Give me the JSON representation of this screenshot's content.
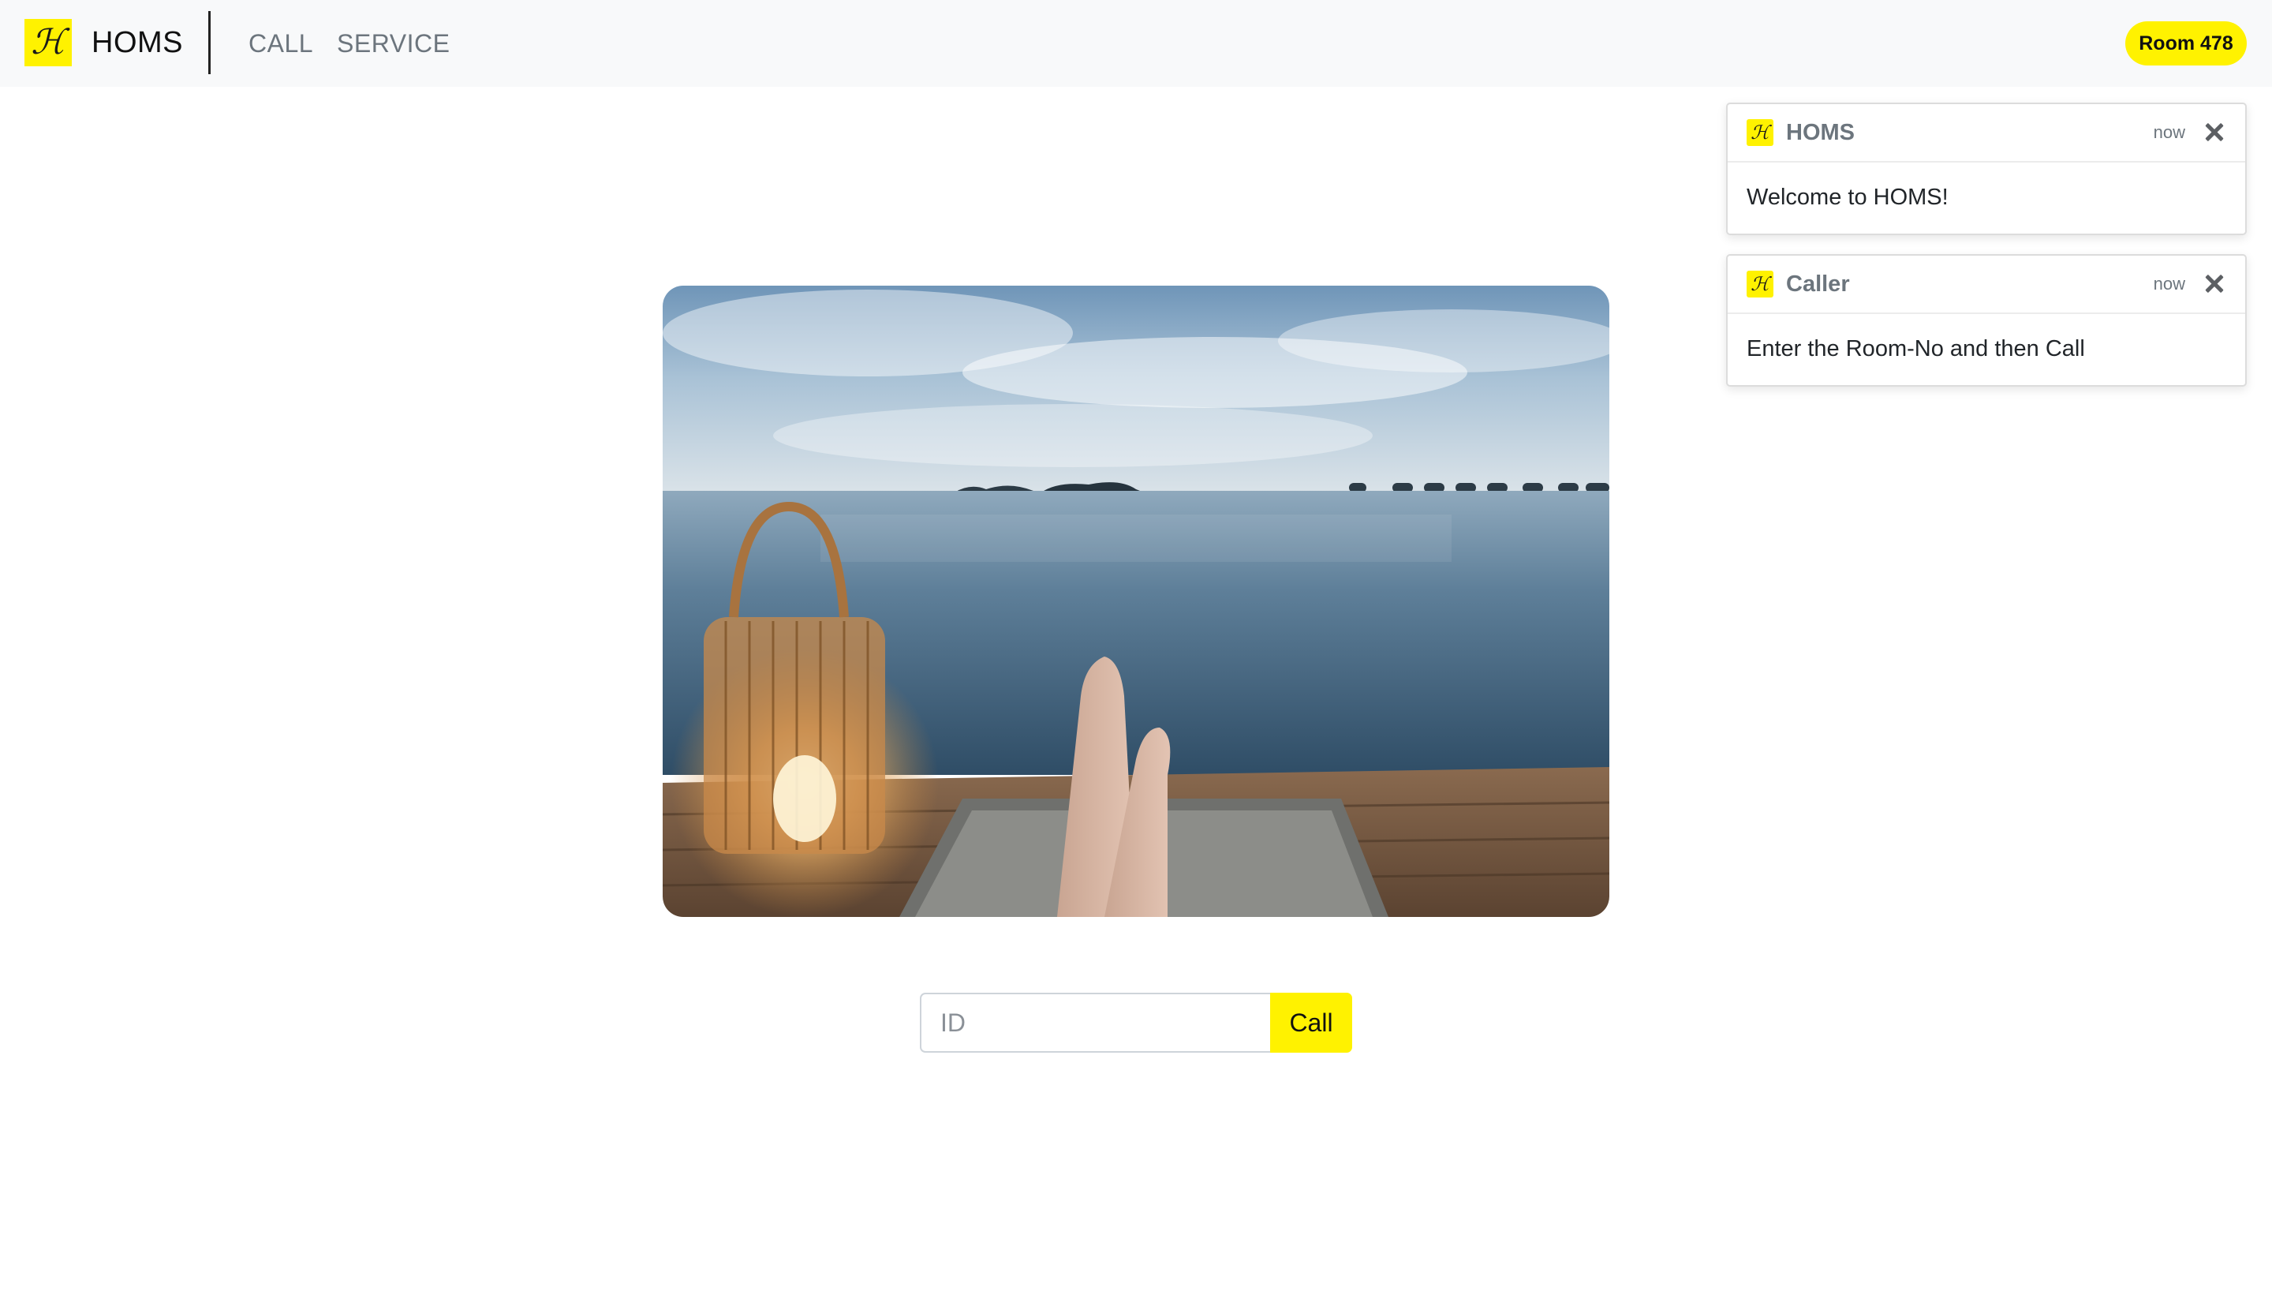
{
  "header": {
    "logo_glyph": "ℋ",
    "brand": "HOMS",
    "nav": [
      {
        "label": "CALL"
      },
      {
        "label": "SERVICE"
      }
    ],
    "room_badge": "Room 478"
  },
  "toasts": [
    {
      "logo_glyph": "ℋ",
      "title": "HOMS",
      "time": "now",
      "message": "Welcome to HOMS!"
    },
    {
      "logo_glyph": "ℋ",
      "title": "Caller",
      "time": "now",
      "message": "Enter the Room-No and then Call"
    }
  ],
  "call_form": {
    "id_placeholder": "ID",
    "id_value": "",
    "call_label": "Call"
  },
  "colors": {
    "accent": "#fff200",
    "navbar_bg": "#f8f9fa",
    "nav_text": "#6c757d"
  },
  "icons": {
    "logo": "homs-logo-icon",
    "close": "close-icon"
  }
}
